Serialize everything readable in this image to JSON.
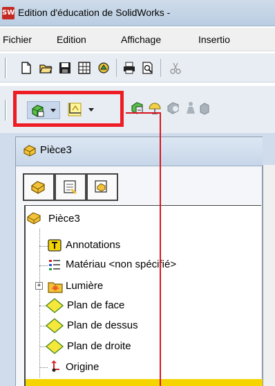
{
  "window": {
    "title": "Edition d'éducation de SolidWorks -",
    "app_icon_text": "SW"
  },
  "menubar": {
    "items": [
      "Fichier",
      "Edition",
      "Affichage",
      "Insertio"
    ]
  },
  "standard_toolbar": {
    "icons": [
      "new-document-icon",
      "open-folder-icon",
      "save-icon",
      "floppy-grid-icon",
      "rebuild-icon",
      "print-icon",
      "print-preview-icon",
      "cut-icon"
    ]
  },
  "feature_toolbar": {
    "split_buttons": [
      "extruded-boss-icon",
      "sketch-icon"
    ],
    "icons": [
      "feature-icon",
      "reference-icon",
      "gray-feature-icon",
      "gray-figure-icon",
      "gray-part-icon"
    ]
  },
  "feature_manager": {
    "title": "Pièce3",
    "tabs": [
      "feature-tree-tab-icon",
      "property-manager-tab-icon",
      "configuration-manager-tab-icon"
    ],
    "tree": {
      "root": "Pièce3",
      "items": [
        {
          "label": "Annotations",
          "icon": "annotations-icon"
        },
        {
          "label": "Matériau <non spécifié>",
          "icon": "material-icon"
        },
        {
          "label": "Lumière",
          "icon": "lights-icon",
          "expander": "+"
        },
        {
          "label": "Plan de face",
          "icon": "plane-icon"
        },
        {
          "label": "Plan de dessus",
          "icon": "plane-icon"
        },
        {
          "label": "Plan de droite",
          "icon": "plane-icon"
        },
        {
          "label": "Origine",
          "icon": "origin-icon"
        }
      ]
    }
  },
  "colors": {
    "annotation_red": "#e8141e",
    "highlight_red": "#ee1c24",
    "selection_yellow": "#f5d400"
  }
}
